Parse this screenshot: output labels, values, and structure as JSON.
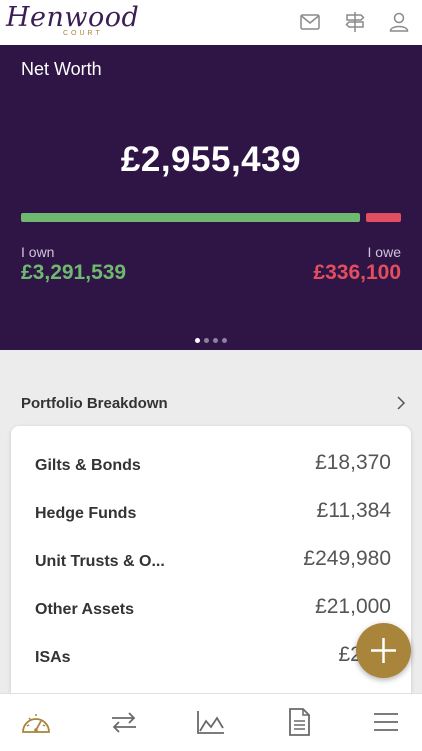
{
  "header": {
    "logo_script": "Henwood",
    "logo_sub": "COURT",
    "icons": [
      "mail-icon",
      "signpost-icon",
      "profile-icon"
    ]
  },
  "net_worth": {
    "title": "Net Worth",
    "value": "£2,955,439",
    "own_label": "I own",
    "own_value": "£3,291,539",
    "owe_label": "I owe",
    "owe_value": "£336,100",
    "own_fraction": 0.907,
    "pages": 4,
    "active_page": 1,
    "colors": {
      "background": "#2e1545",
      "own": "#6fb86f",
      "owe": "#e24e60"
    }
  },
  "portfolio": {
    "title": "Portfolio Breakdown",
    "rows": [
      {
        "label": "Gilts & Bonds",
        "value": "£18,370"
      },
      {
        "label": "Hedge Funds",
        "value": "£11,384"
      },
      {
        "label": "Unit Trusts & O...",
        "value": "£249,980"
      },
      {
        "label": "Other Assets",
        "value": "£21,000"
      },
      {
        "label": "ISAs",
        "value": "£271,"
      }
    ]
  },
  "fab": {
    "icon": "plus-icon",
    "color": "#a8853a"
  },
  "tabbar": {
    "tabs": [
      {
        "icon": "dashboard-gauge-icon",
        "active": true
      },
      {
        "icon": "transfer-arrows-icon",
        "active": false
      },
      {
        "icon": "chart-icon",
        "active": false
      },
      {
        "icon": "document-icon",
        "active": false
      },
      {
        "icon": "menu-icon",
        "active": false
      }
    ],
    "active_color": "#a8853a"
  }
}
